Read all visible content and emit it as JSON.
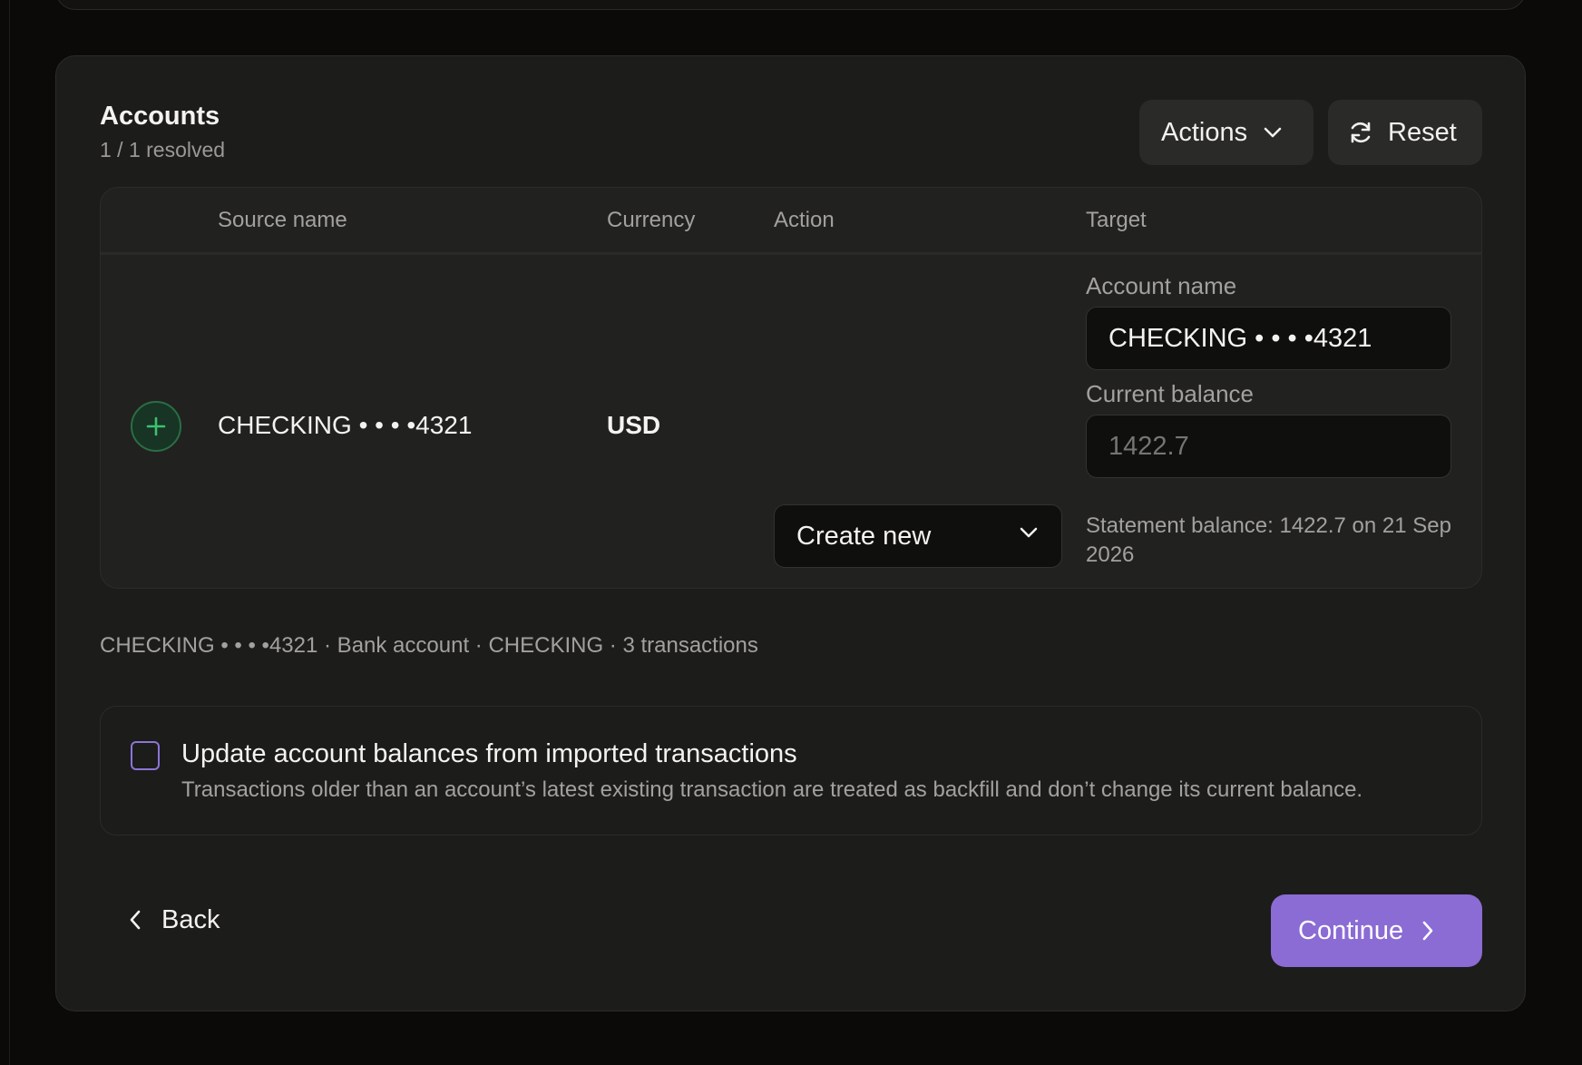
{
  "section": {
    "title": "Accounts",
    "subtitle": "1 / 1 resolved"
  },
  "toolbar": {
    "actions_label": "Actions",
    "reset_label": "Reset"
  },
  "table": {
    "columns": [
      "Source name",
      "Currency",
      "Action",
      "Target"
    ],
    "rows": [
      {
        "source_name": "CHECKING • • • •4321",
        "currency": "USD",
        "action": "Create new",
        "target": {
          "account_name_label": "Account name",
          "account_name_value": "CHECKING • • • •4321",
          "current_balance_label": "Current balance",
          "current_balance_placeholder": "1422.7",
          "statement_hint": "Statement balance: 1422.7 on 21 Sep 2026"
        }
      }
    ]
  },
  "summary": "CHECKING • • • •4321 · Bank account · CHECKING · 3 transactions",
  "update_option": {
    "checked": false,
    "label": "Update account balances from imported transactions",
    "description": "Transactions older than an account’s latest existing transaction are treated as backfill and don’t change its current balance."
  },
  "footer": {
    "back_label": "Back",
    "continue_label": "Continue"
  },
  "colors": {
    "background": "#0b0a09",
    "card": "#1c1c1b",
    "accent": "#8b6bd4",
    "success": "#3fbf6e"
  },
  "icons": {
    "actions": "chevron-down-icon",
    "reset": "refresh-icon",
    "add": "plus-icon",
    "select": "chevron-down-icon",
    "back": "chevron-left-icon",
    "continue": "chevron-right-icon"
  }
}
